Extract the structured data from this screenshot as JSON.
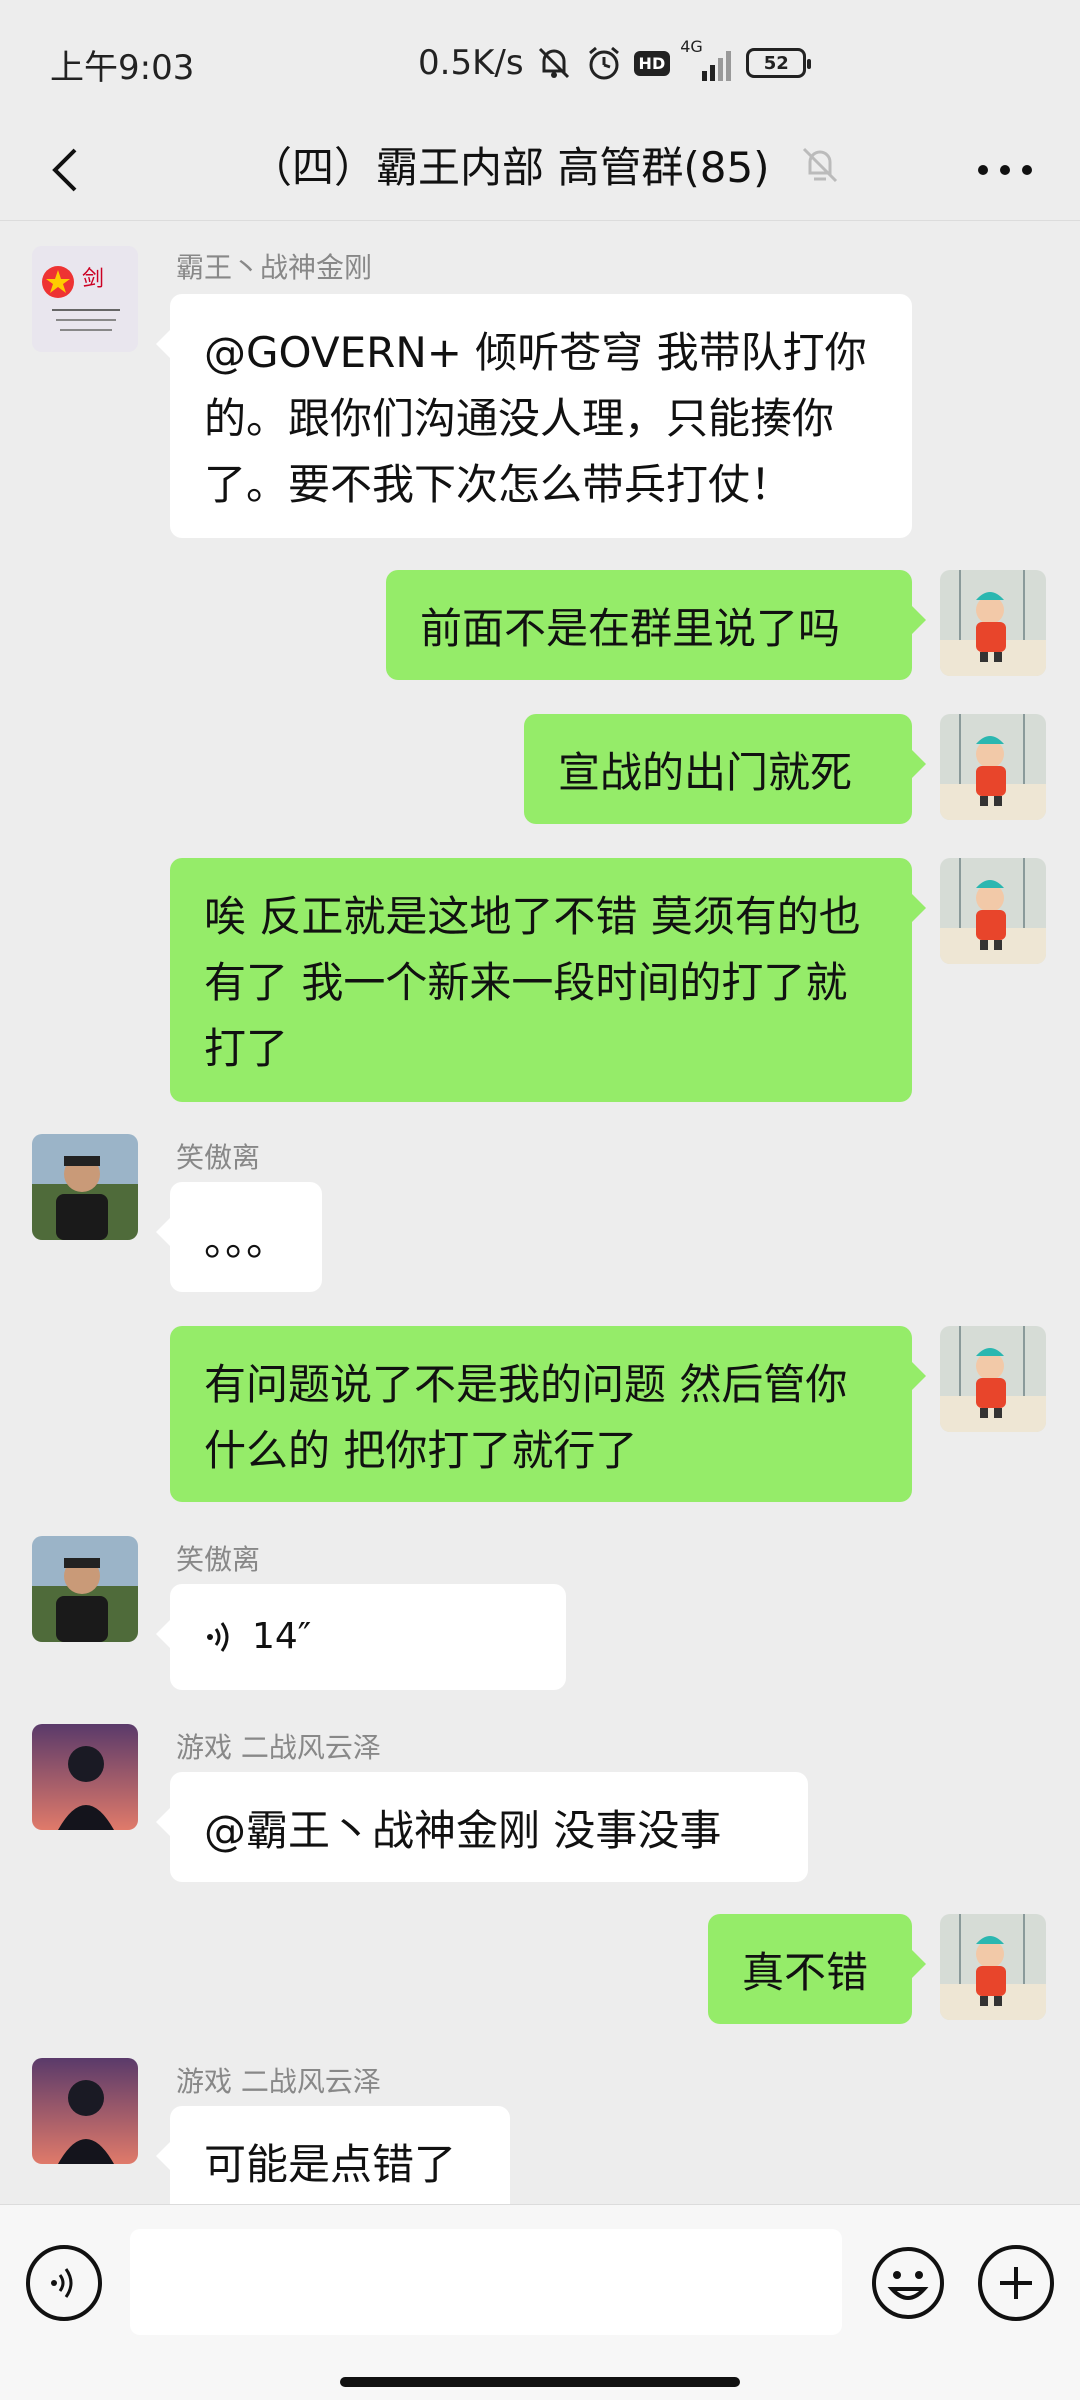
{
  "status_bar": {
    "time": "上午9:03",
    "net_speed": "0.5K/s",
    "hd": "HD",
    "signal_label": "4G",
    "battery": "52"
  },
  "header": {
    "title": "（四）霸王内部 高管群(85)"
  },
  "messages": [
    {
      "dir": "in",
      "sender": "霸王丶战神金刚",
      "avatar": "avatar-bawang",
      "text": "@GOVERN+ 倾听苍穹  我带队打你的。跟你们沟通没人理，只能揍你了。要不我下次怎么带兵打仗！"
    },
    {
      "dir": "out",
      "avatar": "avatar-self",
      "text": "前面不是在群里说了吗"
    },
    {
      "dir": "out",
      "avatar": "avatar-self",
      "text": "宣战的出门就死"
    },
    {
      "dir": "out",
      "avatar": "avatar-self",
      "text": "唉 反正就是这地了不错 莫须有的也有了 我一个新来一段时间的打了就打了"
    },
    {
      "dir": "in",
      "sender": "笑傲离",
      "avatar": "avatar-xiaoaoli",
      "text": "。。。"
    },
    {
      "dir": "out",
      "avatar": "avatar-self",
      "text": "有问题说了不是我的问题 然后管你什么的 把你打了就行了"
    },
    {
      "dir": "in",
      "sender": "笑傲离",
      "avatar": "avatar-xiaoaoli",
      "voice": "14″"
    },
    {
      "dir": "in",
      "sender": "游戏 二战风云泽",
      "avatar": "avatar-fengyunze",
      "text": "@霸王丶战神金刚  没事没事"
    },
    {
      "dir": "out",
      "avatar": "avatar-self",
      "text": "真不错"
    },
    {
      "dir": "in",
      "sender": "游戏 二战风云泽",
      "avatar": "avatar-fengyunze",
      "text": "可能是点错了"
    }
  ],
  "input": {
    "value": "",
    "placeholder": ""
  },
  "colors": {
    "background": "#ededed",
    "bubble_out": "#95ec69",
    "bubble_in": "#ffffff",
    "sender_text": "#888888"
  }
}
